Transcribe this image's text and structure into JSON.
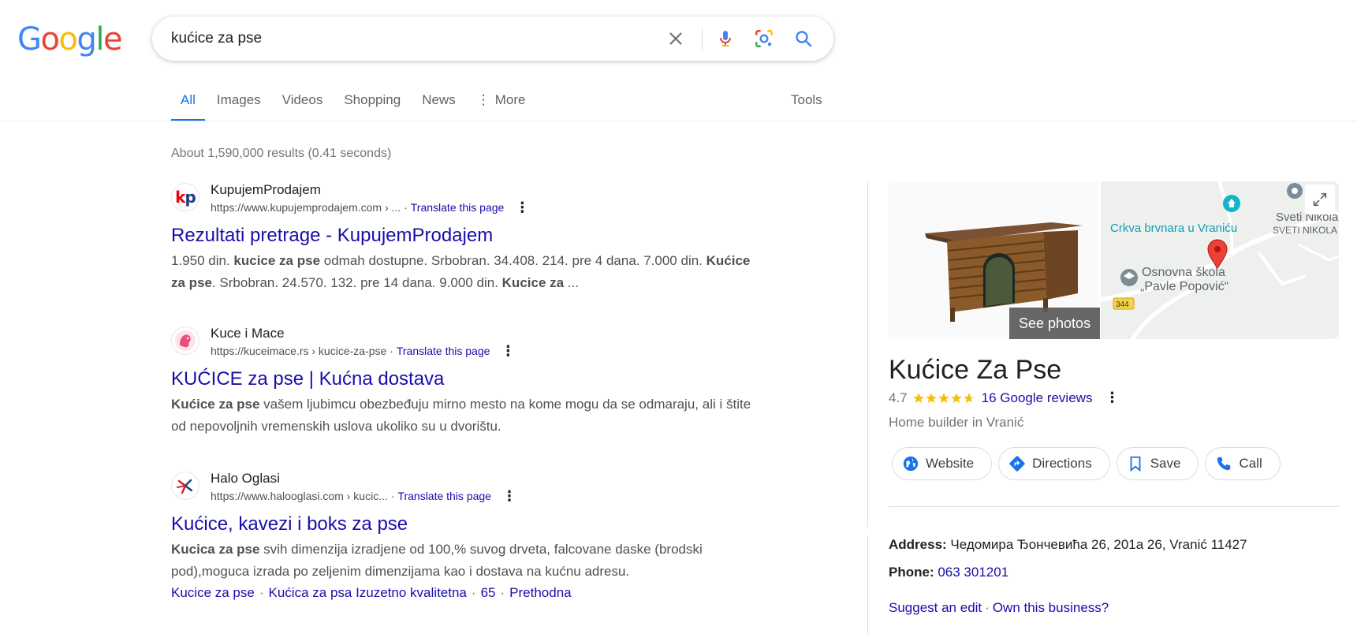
{
  "logo": {
    "text": "Google",
    "letters": [
      "G",
      "o",
      "o",
      "g",
      "l",
      "e"
    ],
    "colors": [
      "#4285F4",
      "#EA4335",
      "#FBBC05",
      "#4285F4",
      "#34A853",
      "#EA4335"
    ]
  },
  "search": {
    "query": "kućice za pse"
  },
  "tabs": [
    "All",
    "Images",
    "Videos",
    "Shopping",
    "News"
  ],
  "more_label": "More",
  "tools_label": "Tools",
  "result_stats": "About 1,590,000 results (0.41 seconds)",
  "results": [
    {
      "site": "KupujemProdajem",
      "url": "https://www.kupujemprodajem.com › ... ·",
      "translate": "Translate this page",
      "favicon_text": "kp",
      "title": "Rezultati pretrage - KupujemProdajem",
      "snippet": [
        {
          "t": "1.950 din. ",
          "b": false
        },
        {
          "t": "kucice za pse",
          "b": true
        },
        {
          "t": " odmah dostupne. Srbobran. 34.408. 214. pre 4 dana. 7.000 din. ",
          "b": false
        },
        {
          "t": "Kućice za pse",
          "b": true
        },
        {
          "t": ". Srbobran. 24.570. 132. pre 14 dana. 9.000 din. ",
          "b": false
        },
        {
          "t": "Kucice za",
          "b": true
        },
        {
          "t": " ...",
          "b": false
        }
      ]
    },
    {
      "site": "Kuce i Mace",
      "url": "https://kuceimace.rs › kucice-za-pse ·",
      "translate": "Translate this page",
      "title": "KUĆICE za pse | Kućna dostava",
      "snippet": [
        {
          "t": "Kućice za pse",
          "b": true
        },
        {
          "t": " vašem ljubimcu obezbeđuju mirno mesto na kome mogu da se odmaraju, ali i štite od nepovoljnih vremenskih uslova ukoliko su u dvorištu.",
          "b": false
        }
      ]
    },
    {
      "site": "Halo Oglasi",
      "url": "https://www.halooglasi.com › kucic... ·",
      "translate": "Translate this page",
      "title": "Kućice, kavezi i boks za pse",
      "snippet": [
        {
          "t": "Kucica za pse",
          "b": true
        },
        {
          "t": " svih dimenzija izradjene od 100,% suvog drveta, falcovane daske (brodski pod),moguca izrada po zeljenim dimenzijama kao i dostava na kućnu adresu.",
          "b": false
        }
      ],
      "sitelinks": [
        "Kucice za pse",
        "Kućica za psa Izuzetno kvalitetna",
        "65",
        "Prethodna"
      ]
    }
  ],
  "knowledge_panel": {
    "see_photos": "See photos",
    "map_labels": {
      "church": "Crkva brvnara u Vraniću",
      "school_line1": "Osnovna škola",
      "school_line2": "„Pavle Popović“",
      "sveti1": "Sveti Nikola",
      "sveti2": "SVETI NIKOLA",
      "road": "344"
    },
    "title": "Kućice Za Pse",
    "rating": "4.7",
    "rating_value": 4.7,
    "reviews": "16 Google reviews",
    "category": "Home builder in Vranić",
    "actions": [
      "Website",
      "Directions",
      "Save",
      "Call"
    ],
    "address_label": "Address:",
    "address": "Чедомира Ђончевића 26, 201а 26, Vranić 11427",
    "phone_label": "Phone:",
    "phone": "063 301201",
    "suggest_edit": "Suggest an edit",
    "own_business": "Own this business?"
  }
}
